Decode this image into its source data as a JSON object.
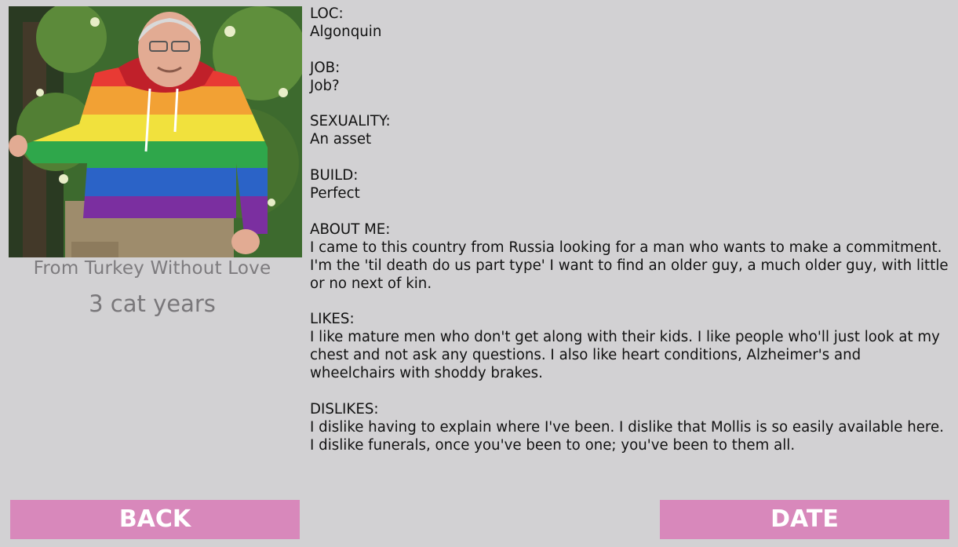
{
  "profile": {
    "name": "From Turkey Without Love",
    "age": "3 cat years",
    "photo_icon": "profile-photo-icon"
  },
  "details": {
    "loc": {
      "label": "LOC:",
      "value": "Algonquin"
    },
    "job": {
      "label": "JOB:",
      "value": "Job?"
    },
    "sexuality": {
      "label": "SEXUALITY:",
      "value": "An asset"
    },
    "build": {
      "label": "BUILD:",
      "value": "Perfect"
    },
    "about": {
      "label": "ABOUT ME:",
      "value": "I came to this country from Russia looking for a man who wants to make a commitment. I'm the 'til death do us part type' I want to find an older guy, a much older guy, with little or no next of kin."
    },
    "likes": {
      "label": "LIKES:",
      "value": "I like mature men who don't get along with their kids. I like people who'll just look at my chest and not ask any questions. I also like heart conditions, Alzheimer's and wheelchairs with shoddy brakes."
    },
    "dislikes": {
      "label": "DISLIKES:",
      "value": "I dislike having to explain where I've been. I dislike that Mollis is so easily available here. I dislike funerals, once you've been to one; you've been to them all."
    }
  },
  "buttons": {
    "back_label": "BACK",
    "date_label": "DATE"
  },
  "colors": {
    "background": "#d2d1d3",
    "button": "#d888bb",
    "button_text": "#ffffff",
    "profile_text": "#7d7b7e",
    "body_text": "#121212"
  }
}
